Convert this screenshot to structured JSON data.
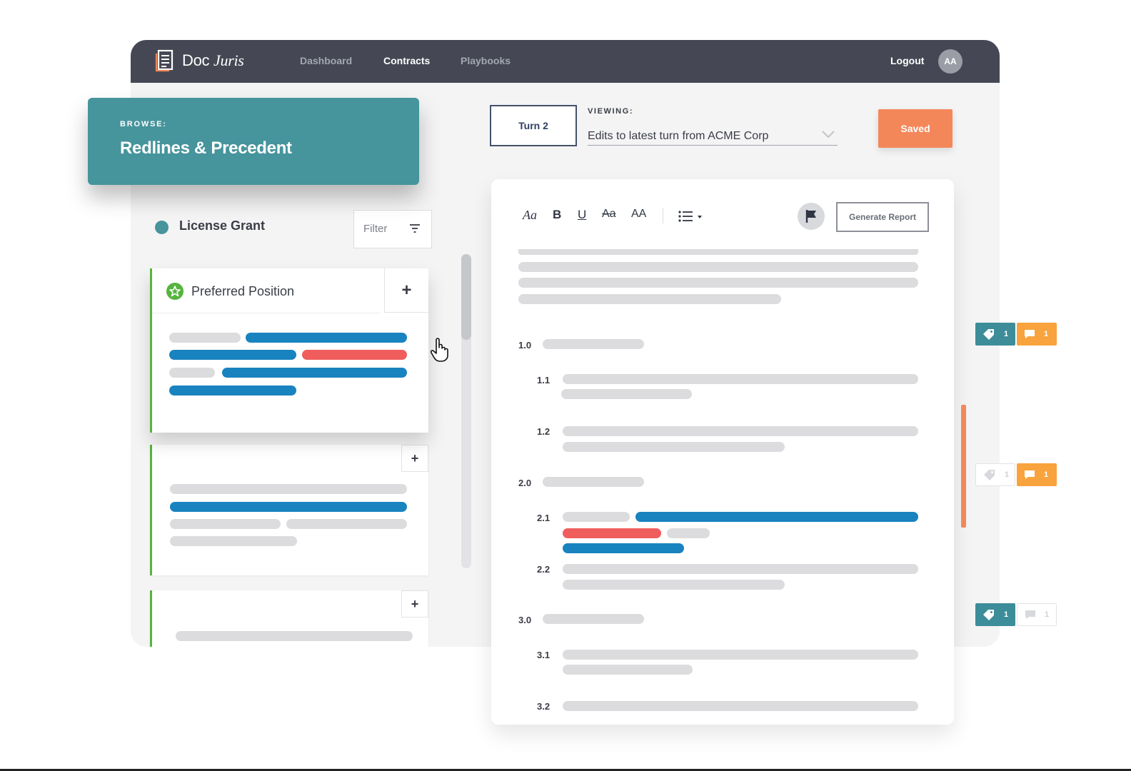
{
  "brand": {
    "name_part1": "Doc",
    "name_part2": "Juris"
  },
  "nav": {
    "items": [
      {
        "label": "Dashboard",
        "active": false
      },
      {
        "label": "Contracts",
        "active": true
      },
      {
        "label": "Playbooks",
        "active": false
      }
    ],
    "logout_label": "Logout",
    "avatar_initials": "AA"
  },
  "browse": {
    "label": "BROWSE:",
    "title": "Redlines & Precedent"
  },
  "left_panel": {
    "category": "License Grant",
    "filter_label": "Filter",
    "cards": [
      {
        "title": "Preferred Position",
        "add_label": "+"
      },
      {
        "title": "",
        "add_label": "+"
      },
      {
        "title": "",
        "add_label": "+"
      }
    ]
  },
  "viewer": {
    "turn_label": "Turn 2",
    "viewing_label": "VIEWING:",
    "viewing_value": "Edits to latest turn from ACME Corp",
    "saved_label": "Saved"
  },
  "editor": {
    "toolbar": {
      "font_style": "Aa",
      "bold": "B",
      "underline": "U",
      "strikethrough": "Aa",
      "caps": "AA",
      "report_label": "Generate Report"
    },
    "sections": [
      "1.0",
      "1.1",
      "1.2",
      "2.0",
      "2.1",
      "2.2",
      "3.0",
      "3.1",
      "3.2"
    ]
  },
  "annotations": [
    {
      "tags": "1",
      "comments": "1",
      "tags_active": true,
      "comments_active": true
    },
    {
      "tags": "1",
      "comments": "1",
      "tags_active": false,
      "comments_active": true
    },
    {
      "tags": "1",
      "comments": "1",
      "tags_active": true,
      "comments_active": false
    }
  ],
  "colors": {
    "navbar": "#454854",
    "teal": "#46949c",
    "accent_orange": "#f4875a",
    "insert_blue": "#1983bf",
    "delete_red": "#f05d5d",
    "preferred_green": "#55b43e"
  }
}
